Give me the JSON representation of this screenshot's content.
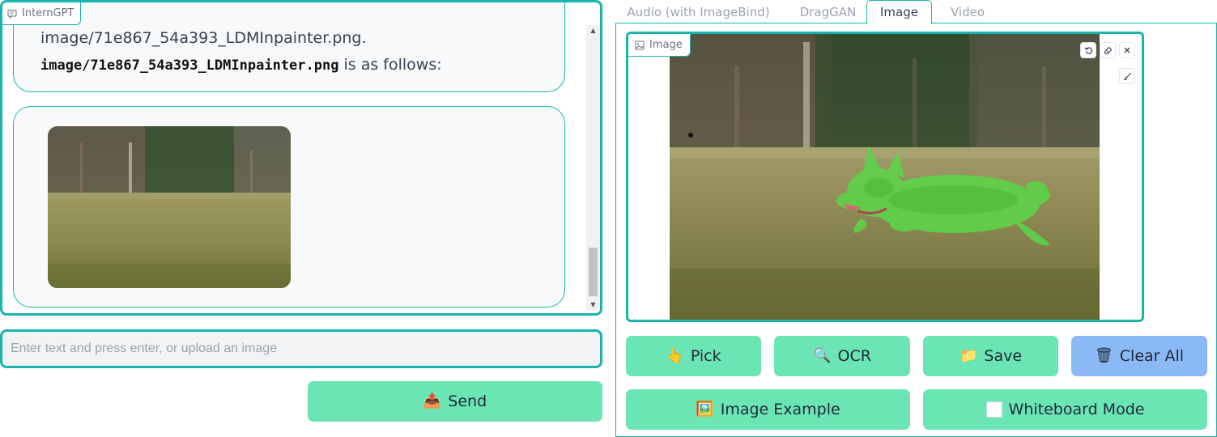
{
  "chat": {
    "label": "InternGPT",
    "message_line1": "image/71e867_54a393_LDMInpainter.png.",
    "message_filename": "image/71e867_54a393_LDMInpainter.png",
    "message_suffix": " is as follows:"
  },
  "input": {
    "placeholder": "Enter text and press enter, or upload an image",
    "value": ""
  },
  "send_button": {
    "icon": "📤",
    "label": "Send"
  },
  "tabs": [
    {
      "label": "Audio (with ImageBind)",
      "selected": false
    },
    {
      "label": "DragGAN",
      "selected": false
    },
    {
      "label": "Image",
      "selected": true
    },
    {
      "label": "Video",
      "selected": false
    }
  ],
  "image_editor": {
    "label": "Image",
    "tools": [
      "undo-icon",
      "eraser-icon",
      "close-icon",
      "brush-icon"
    ]
  },
  "buttons": {
    "pick": {
      "icon": "👆",
      "label": "Pick"
    },
    "ocr": {
      "icon": "🔍",
      "label": "OCR"
    },
    "save": {
      "icon": "📁",
      "label": "Save"
    },
    "clear": {
      "icon": "🗑",
      "label": "Clear All"
    },
    "example": {
      "icon": "🖼️",
      "label": "Image Example"
    },
    "whiteboard": {
      "label": "Whiteboard Mode",
      "checked": false
    }
  },
  "colors": {
    "accent": "#17b5ae",
    "button_green": "#6ce5b5",
    "button_blue": "#8ab9f5",
    "mask_green": "#5fd14a"
  }
}
